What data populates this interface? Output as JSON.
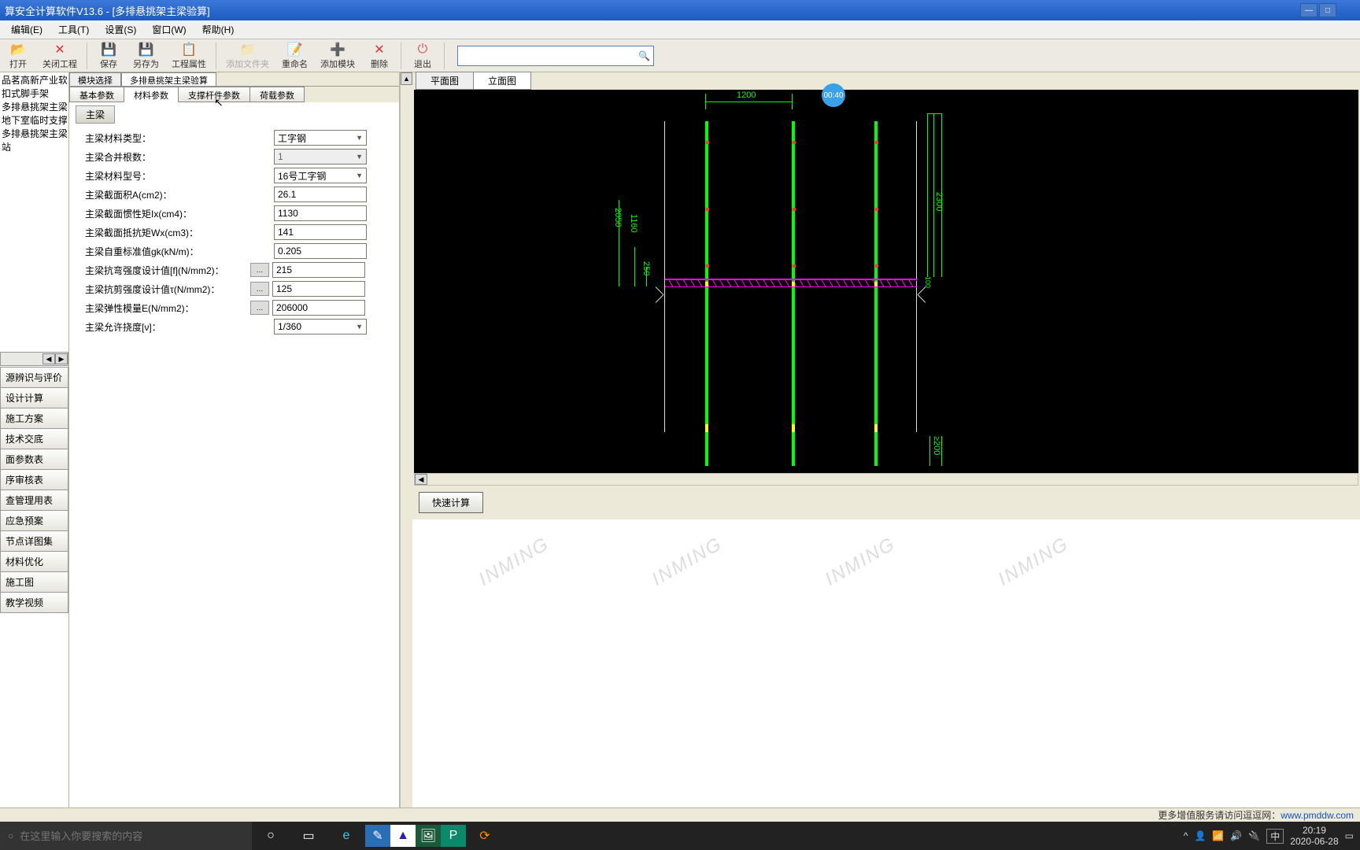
{
  "title": "算安全计算软件V13.6 - [多排悬挑架主梁验算]",
  "menu": {
    "m1": "编辑(E)",
    "m2": "工具(T)",
    "m3": "设置(S)",
    "m4": "窗口(W)",
    "m5": "帮助(H)"
  },
  "toolbar": {
    "open": "打开",
    "close_proj": "关闭工程",
    "save": "保存",
    "saveas": "另存为",
    "proj_prop": "工程属性",
    "add_folder": "添加文件夹",
    "rename": "重命名",
    "add_module": "添加模块",
    "delete": "删除",
    "exit": "退出"
  },
  "tree": {
    "t0": "品茗高新产业软",
    "t1": "扣式脚手架",
    "t2": "多排悬挑架主梁验",
    "t3": "地下室临时支撑设",
    "t4": "多排悬挑架主梁验",
    "t5": "站"
  },
  "bottom": {
    "b0": "源辨识与评价",
    "b1": "设计计算",
    "b2": "施工方案",
    "b3": "技术交底",
    "b4": "面参数表",
    "b5": "序审核表",
    "b6": "查管理用表",
    "b7": "应急预案",
    "b8": "节点详图集",
    "b9": "材料优化",
    "b10": "施工图",
    "b11": "教学视频"
  },
  "top_tabs": {
    "t1": "模块选择",
    "t2": "多排悬挑架主梁验算"
  },
  "param_tabs": {
    "p1": "基本参数",
    "p2": "材料参数",
    "p3": "支撑杆件参数",
    "p4": "荷载参数"
  },
  "group": "主梁",
  "form": {
    "l0": "主梁材料类型：",
    "v0": "工字钢",
    "l1": "主梁合并根数：",
    "v1": "1",
    "l2": "主梁材料型号：",
    "v2": "16号工字钢",
    "l3": "主梁截面积A(cm2)：",
    "v3": "26.1",
    "l4": "主梁截面惯性矩Ix(cm4)：",
    "v4": "1130",
    "l5": "主梁截面抵抗矩Wx(cm3)：",
    "v5": "141",
    "l6": "主梁自重标准值gk(kN/m)：",
    "v6": "0.205",
    "l7": "主梁抗弯强度设计值[f](N/mm2)：",
    "v7": "215",
    "l8": "主梁抗剪强度设计值τ(N/mm2)：",
    "v8": "125",
    "l9": "主梁弹性模量E(N/mm2)：",
    "v9": "206000",
    "l10": "主梁允许挠度[ν]：",
    "v10": "1/360"
  },
  "view_tabs": {
    "vt1": "平面图",
    "vt2": "立面图"
  },
  "canvas_dims": {
    "d1": "1200",
    "d2": "2050",
    "d3": "1160",
    "d4": "250",
    "d5": "2300",
    "d6": "100",
    "d7": "≥200"
  },
  "calc_btn": "快速计算",
  "status": {
    "text": "更多增值服务请访问逗逗网：",
    "url": "www.pmddw.com"
  },
  "badge": "00:40",
  "taskbar": {
    "search_ph": "在这里输入你要搜索的内容",
    "ime": "中",
    "time": "20:19",
    "date": "2020-06-28"
  }
}
